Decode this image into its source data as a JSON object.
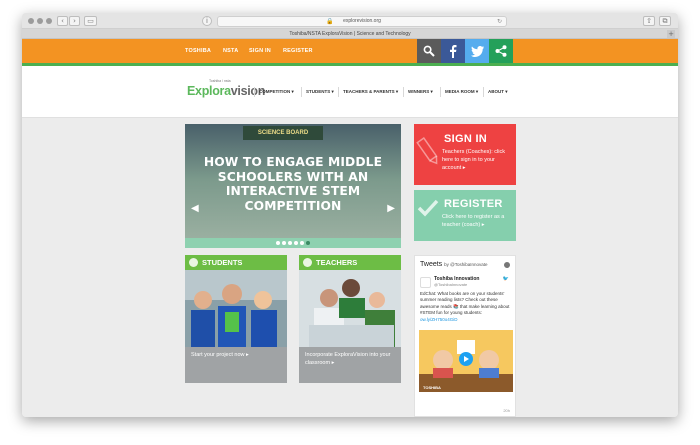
{
  "browser": {
    "url": "explorevision.org",
    "tab_title": "Toshiba/NSTA ExploraVision | Science and Technology",
    "back_glyph": "‹",
    "forward_glyph": "›",
    "new_tab_glyph": "+"
  },
  "topbar": {
    "links": [
      "TOSHIBA",
      "NSTA",
      "SIGN IN",
      "REGISTER"
    ],
    "social": [
      {
        "name": "search-icon",
        "color": "#5b5b5b"
      },
      {
        "name": "facebook-icon",
        "color": "#3b5998"
      },
      {
        "name": "twitter-icon",
        "color": "#55acee"
      },
      {
        "name": "share-icon",
        "color": "#24a05a"
      }
    ],
    "bar_color": "#f39322"
  },
  "logo": {
    "tagline": "Toshiba / nsta",
    "part1": "Explo",
    "part2": "ra",
    "part3": "vision"
  },
  "nav": {
    "items": [
      "COMPETITION",
      "STUDENTS",
      "TEACHERS & PARENTS",
      "WINNERS",
      "MEDIA ROOM",
      "ABOUT"
    ]
  },
  "slider": {
    "board_text": "SCIENCE BOARD",
    "title": "HOW TO ENGAGE MIDDLE SCHOOLERS WITH AN INTERACTIVE STEM COMPETITION",
    "prev": "◀",
    "next": "▶",
    "dots": 6,
    "active_dot": 5
  },
  "cta": {
    "signin_title": "SIGN IN",
    "signin_text": "Teachers (Coaches): click here to sign in to your account ▸",
    "register_title": "REGISTER",
    "register_text": "Click here to register as a teacher (coach) ▸"
  },
  "cards": {
    "students_title": "STUDENTS",
    "students_text": "Start your project now ▸",
    "teachers_title": "TEACHERS",
    "teachers_text": "Incorporate ExploraVision into your classroom ▸"
  },
  "tweets": {
    "title": "Tweets",
    "by": "by @ToshibaInnovate",
    "name": "Toshiba Innovation",
    "handle": "@ToshibaInnovate",
    "text": "EdChat: What books are on your students' summer reading lists? Check out these awesome reads 📚 that make learning about #STEM fun for young students:",
    "link": "ow.ly/ZH750o4GiD",
    "media_caption": "TOSHIBA",
    "footer": "20h"
  }
}
